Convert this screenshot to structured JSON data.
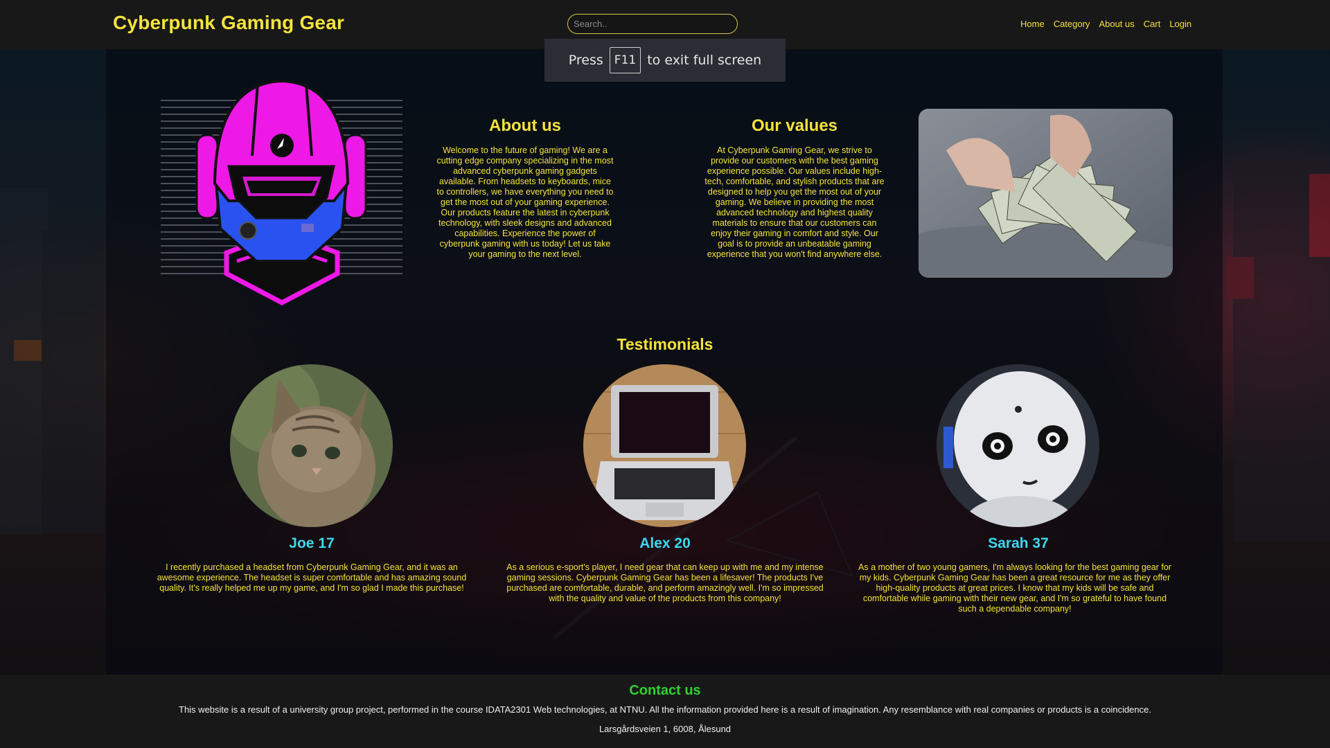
{
  "header": {
    "brand": "Cyberpunk Gaming Gear",
    "search_placeholder": "Search..",
    "nav": [
      "Home",
      "Category",
      "About us",
      "Cart",
      "Login"
    ]
  },
  "toast": {
    "press": "Press",
    "key": "F11",
    "rest": "to exit full screen"
  },
  "about": {
    "title": "About us",
    "text": "Welcome to the future of gaming! We are a cutting edge company specializing in the most advanced cyberpunk gaming gadgets available. From headsets to keyboards, mice to controllers, we have everything you need to get the most out of your gaming experience. Our products feature the latest in cyberpunk technology, with sleek designs and advanced capabilities. Experience the power of cyberpunk gaming with us today! Let us take your gaming to the next level."
  },
  "values": {
    "title": "Our values",
    "text": "At Cyberpunk Gaming Gear, we strive to provide our customers with the best gaming experience possible. Our values include high-tech, comfortable, and stylish products that are designed to help you get the most out of your gaming. We believe in providing the most advanced technology and highest quality materials to ensure that our customers can enjoy their gaming in comfort and style. Our goal is to provide an unbeatable gaming experience that you won't find anywhere else."
  },
  "testimonials": {
    "title": "Testimonials",
    "items": [
      {
        "name": "Joe 17",
        "text": "I recently purchased a headset from Cyberpunk Gaming Gear, and it was an awesome experience. The headset is super comfortable and has amazing sound quality. It's really helped me up my game, and I'm so glad I made this purchase!"
      },
      {
        "name": "Alex 20",
        "text": "As a serious e-sport's player, I need gear that can keep up with me and my intense gaming sessions. Cyberpunk Gaming Gear has been a lifesaver! The products I've purchased are comfortable, durable, and perform amazingly well. I'm so impressed with the quality and value of the products from this company!"
      },
      {
        "name": "Sarah 37",
        "text": "As a mother of two young gamers, I'm always looking for the best gaming gear for my kids. Cyberpunk Gaming Gear has been a great resource for me as they offer high-quality products at great prices. I know that my kids will be safe and comfortable while gaming with their new gear, and I'm so grateful to have found such a dependable company!"
      }
    ]
  },
  "footer": {
    "contact": "Contact us",
    "disclaimer": "This website is a result of a university group project, performed in the course IDATA2301 Web technologies, at NTNU. All the information provided here is a result of imagination. Any resemblance with real companies or products is a coincidence.",
    "address": "Larsgårdsveien 1, 6008, Ålesund"
  },
  "colors": {
    "accent_yellow": "#f5e33d",
    "name_cyan": "#3cd8f0",
    "contact_green": "#2fd12f",
    "helmet_magenta": "#ee19e6",
    "helmet_blue": "#2a52f0"
  }
}
